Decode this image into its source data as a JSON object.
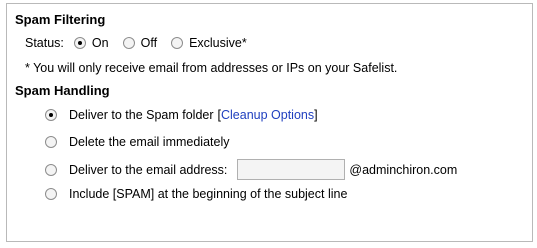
{
  "spam_filtering": {
    "title": "Spam Filtering",
    "status_label": "Status:",
    "options": [
      {
        "label": "On",
        "checked": true
      },
      {
        "label": "Off",
        "checked": false
      },
      {
        "label": "Exclusive*",
        "checked": false
      }
    ],
    "note": "* You will only receive email from addresses or IPs on your Safelist."
  },
  "spam_handling": {
    "title": "Spam Handling",
    "deliver_folder": {
      "label": "Deliver to the Spam folder",
      "link_open": "[",
      "link": "Cleanup Options",
      "link_close": "]",
      "checked": true
    },
    "delete": {
      "label": "Delete the email immediately",
      "checked": false
    },
    "deliver_address": {
      "label": "Deliver to the email address:",
      "value": "",
      "domain": "@adminchiron.com",
      "checked": false
    },
    "tag_subject": {
      "label": "Include [SPAM] at the beginning of the subject line",
      "checked": false
    }
  }
}
